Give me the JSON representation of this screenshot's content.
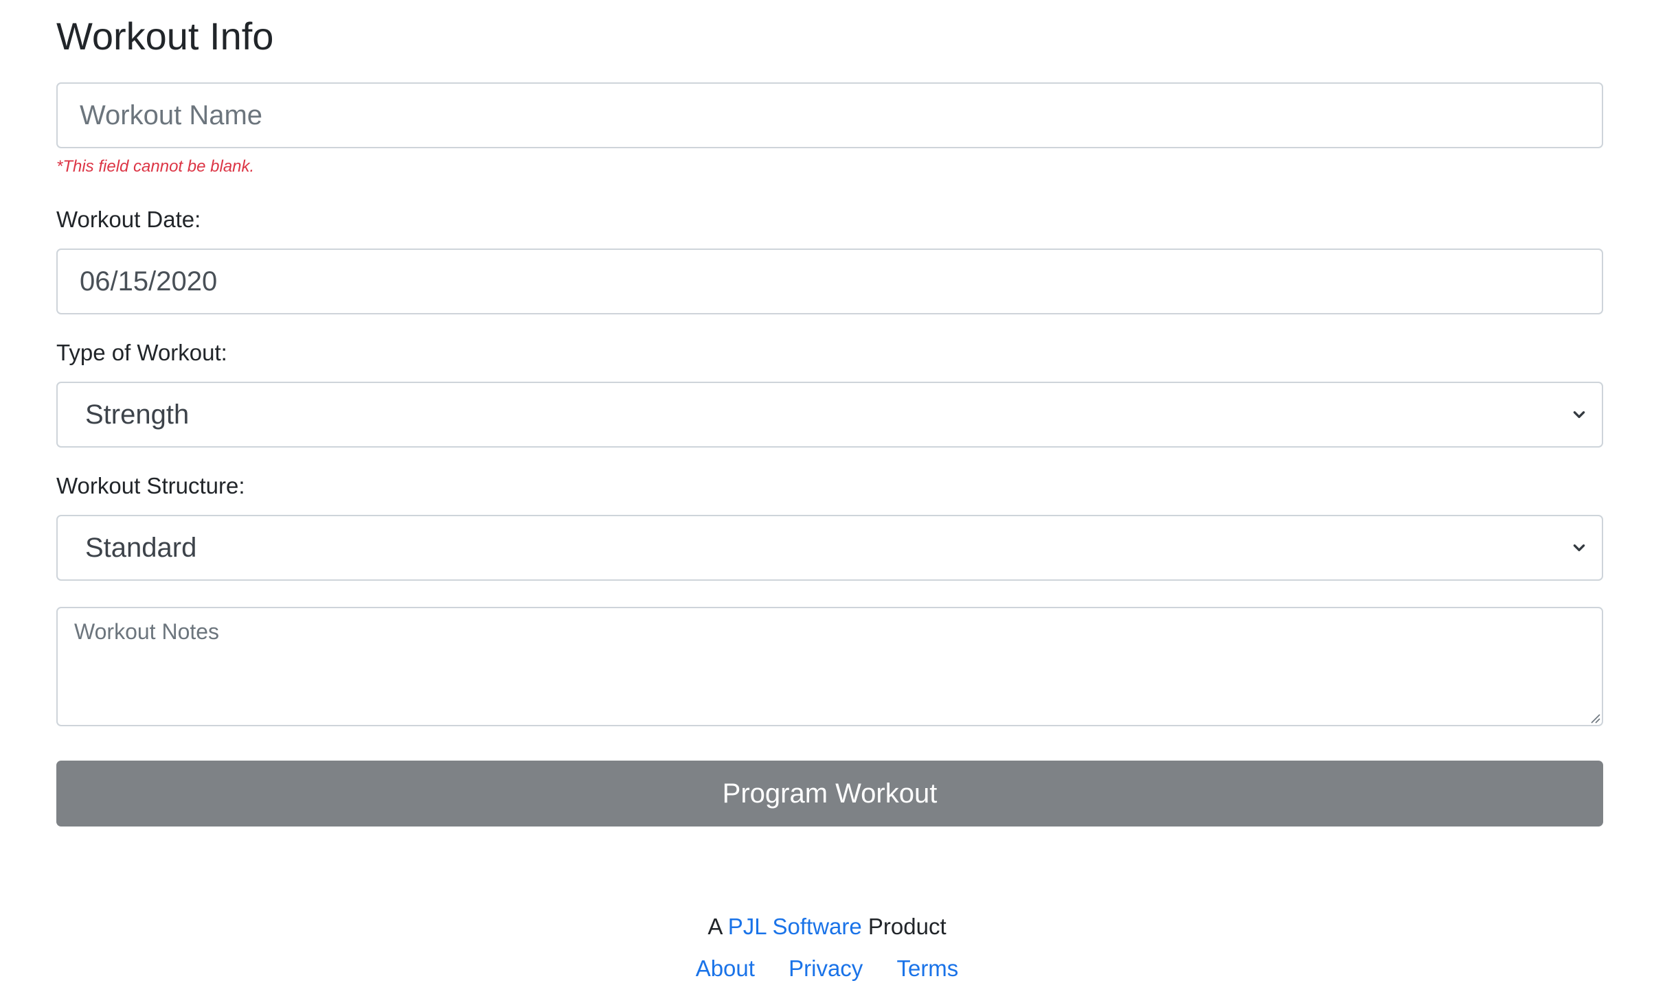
{
  "title": "Workout Info",
  "workout_name": {
    "placeholder": "Workout Name",
    "value": "",
    "error": "*This field cannot be blank."
  },
  "workout_date": {
    "label": "Workout Date:",
    "value": "06/15/2020"
  },
  "workout_type": {
    "label": "Type of Workout:",
    "selected": "Strength"
  },
  "workout_structure": {
    "label": "Workout Structure:",
    "selected": "Standard"
  },
  "notes": {
    "placeholder": "Workout Notes"
  },
  "submit_label": "Program Workout",
  "footer": {
    "prefix": "A",
    "company_link": "PJL Software",
    "suffix": "Product",
    "links": [
      "About",
      "Privacy",
      "Terms"
    ]
  },
  "colors": {
    "accent_link": "#1a73e8",
    "error": "#dc3545",
    "button": "#7e8286"
  },
  "icons": {
    "select_arrow": "chevron-down-icon",
    "textarea_resize": "resize-grip-icon"
  }
}
